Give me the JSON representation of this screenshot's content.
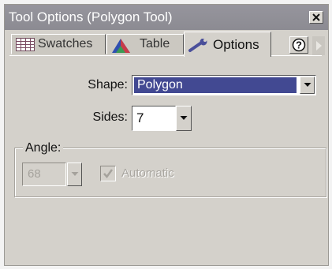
{
  "window": {
    "title": "Tool Options (Polygon Tool)"
  },
  "tabs": [
    {
      "label": "Swatches",
      "icon": "grid-icon",
      "selected": false
    },
    {
      "label": "Table",
      "icon": "color-triangle-icon",
      "selected": false
    },
    {
      "label": "Options",
      "icon": "wrench-icon",
      "selected": true
    }
  ],
  "toolbar_icons": {
    "help": "help-icon",
    "scroll": "scroll-right-arrow-icon"
  },
  "form": {
    "shape": {
      "label": "Shape:",
      "value": "Polygon"
    },
    "sides": {
      "label": "Sides:",
      "value": "7"
    },
    "angle": {
      "group_label": "Angle:",
      "value": "68",
      "disabled": true,
      "automatic": {
        "label": "Automatic",
        "checked": true,
        "disabled": true
      }
    }
  },
  "colors": {
    "title_bar": "#8f8e95",
    "panel": "#d4d1cb",
    "selection": "#424992",
    "disabled_text": "#a9a6a0"
  }
}
